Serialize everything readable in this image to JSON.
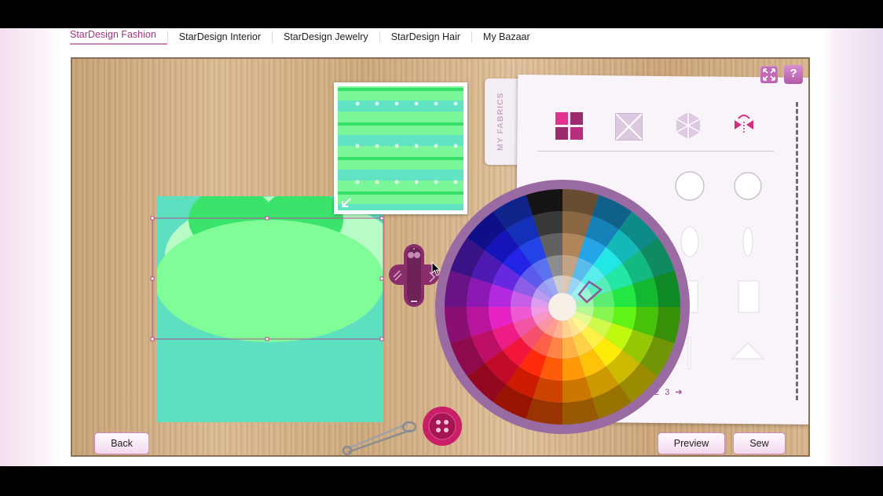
{
  "nav": {
    "tabs": [
      "StarDesign Fashion",
      "StarDesign Interior",
      "StarDesign Jewelry",
      "StarDesign Hair",
      "My Bazaar"
    ],
    "active_index": 0
  },
  "panel": {
    "tab_label": "MY FABRICS",
    "pager": {
      "pages": [
        "2",
        "3"
      ],
      "next_symbol": "➔"
    }
  },
  "help_icon_label": "?",
  "buttons": {
    "back": "Back",
    "preview": "Preview",
    "sew": "Sew"
  },
  "colors": {
    "fabric_base": "#5edfbf",
    "fabric_light": "#b9fbc6",
    "fabric_green": "#3ae46b",
    "fabric_mid": "#80fd97",
    "accent": "#a3337e",
    "wheel_ring": "#9a6ba3"
  },
  "icons": [
    "grid-pattern-icon",
    "diagonal-pattern-icon",
    "hexagon-pattern-icon",
    "mirror-pattern-icon",
    "zoom-icon",
    "help-icon",
    "tool-handle-icon",
    "safety-pin-icon",
    "button-icon",
    "color-wheel",
    "mouse-cursor-icon"
  ]
}
